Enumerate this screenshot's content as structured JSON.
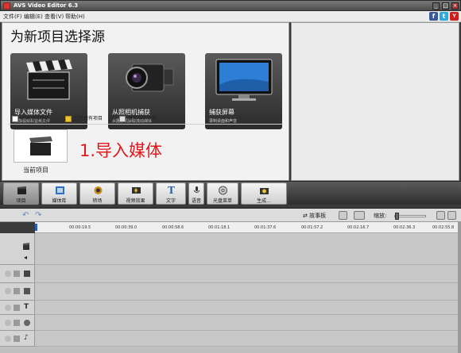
{
  "window": {
    "title": "AVS Video Editor 6.3",
    "controls": [
      "_",
      "□",
      "×"
    ]
  },
  "menu": {
    "items": [
      "文件(F)",
      "编辑(E)",
      "查看(V)",
      "帮助(H)"
    ],
    "social": [
      "f",
      "t",
      "Y"
    ]
  },
  "start": {
    "title": "为新项目选择源",
    "tiles": [
      {
        "label": "导入媒体文件",
        "desc": "添加视频和音频文件"
      },
      {
        "label": "从照相机捕获",
        "desc": "从摄像机获取流动媒体"
      },
      {
        "label": "捕获屏幕",
        "desc": "录制桌面和声音"
      }
    ],
    "links": [
      "创建空白项目",
      "打开现有项目",
      "保存当前项目"
    ],
    "current_project": "当前项目",
    "annotation": "1.导入媒体"
  },
  "toolbar": [
    "项目",
    "媒体库",
    "转场",
    "视频效果",
    "文字",
    "语音",
    "光盘菜单",
    "生成..."
  ],
  "timeline": {
    "storyboard": "故事板",
    "zoom_label": "缩放:",
    "ticks": [
      "00:00:19.5",
      "00:00:39.0",
      "00:00:58.6",
      "00:01:18.1",
      "00:01:37.6",
      "00:01:57.2",
      "00:02:16.7",
      "00:02:36.3",
      "00:02:55.8"
    ]
  },
  "colors": {
    "accent_red": "#e0191e",
    "toolbar_bg": "#3a3a3a",
    "playhead": "#2a5fb8"
  }
}
